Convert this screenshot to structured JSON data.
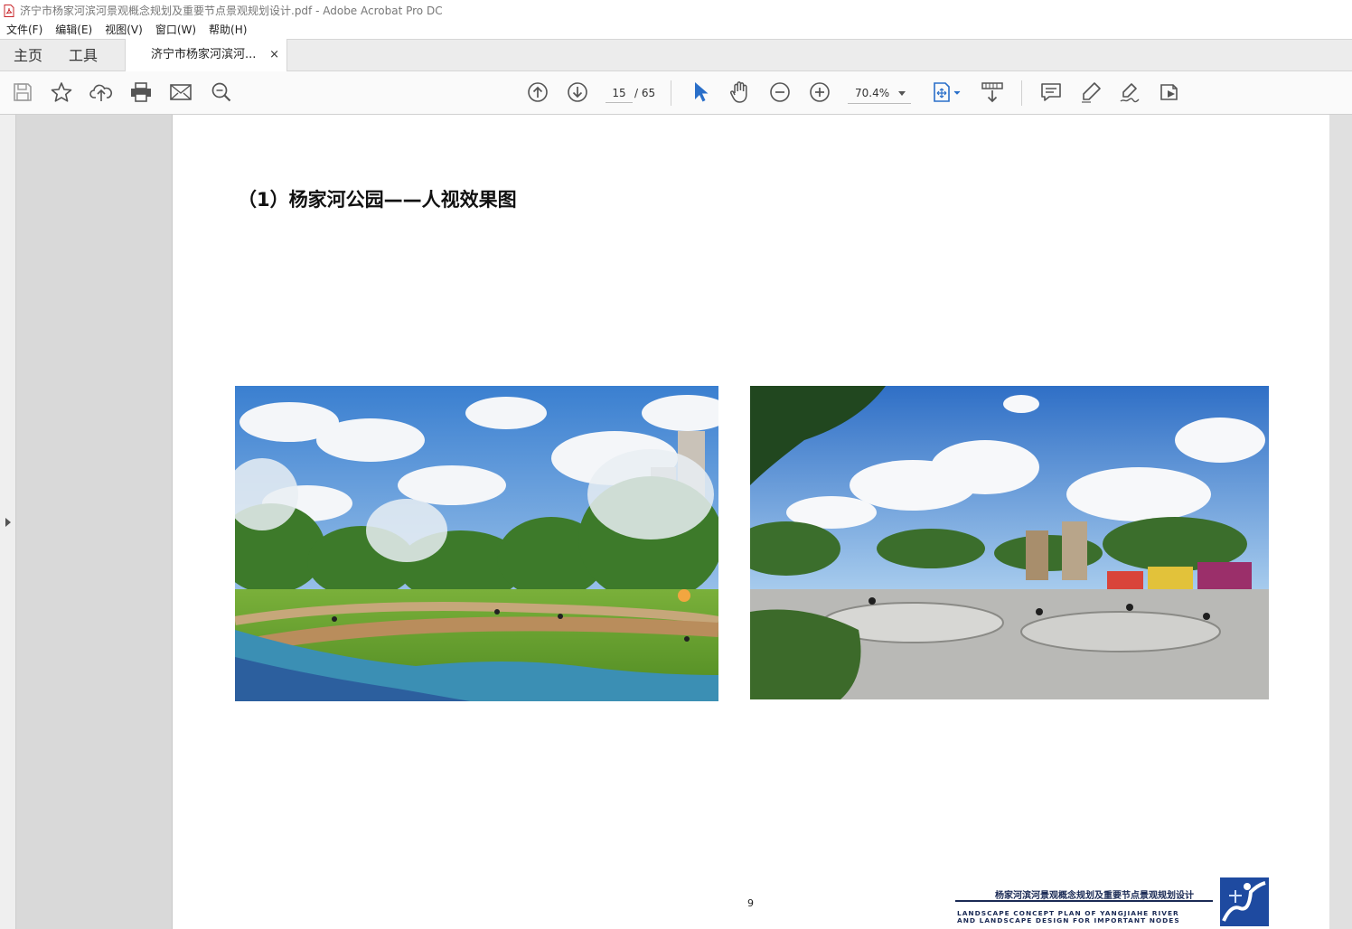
{
  "window": {
    "title": "济宁市杨家河滨河景观概念规划及重要节点景观规划设计.pdf - Adobe Acrobat Pro DC"
  },
  "menubar": {
    "items": [
      {
        "label": "文件(F)"
      },
      {
        "label": "编辑(E)"
      },
      {
        "label": "视图(V)"
      },
      {
        "label": "窗口(W)"
      },
      {
        "label": "帮助(H)"
      }
    ]
  },
  "tabs": {
    "home": "主页",
    "tools": "工具",
    "document": "济宁市杨家河滨河...",
    "close_glyph": "×"
  },
  "toolbar": {
    "page_current": "15",
    "page_total": "/ 65",
    "zoom": "70.4%",
    "icons": [
      "save-icon",
      "bookmark-star-icon",
      "upload-cloud-icon",
      "print-icon",
      "email-icon",
      "search-zoom-icon",
      "prev-page-icon",
      "next-page-icon",
      "select-arrow-icon",
      "hand-icon",
      "zoom-out-icon",
      "zoom-in-icon",
      "fit-page-icon",
      "scroll-mode-icon",
      "comment-icon",
      "highlight-pen-icon",
      "sign-icon",
      "more-tools-icon"
    ]
  },
  "document": {
    "heading": "（1）杨家河公园——人视效果图",
    "page_number": "9",
    "footer_cn": "杨家河滨河景观概念规划及重要节点景观规划设计",
    "footer_en_line1": "LANDSCAPE CONCEPT PLAN OF YANGJIAHE RIVER",
    "footer_en_line2": "AND LANDSCAPE DESIGN FOR IMPORTANT NODES",
    "images": [
      "park-lawn-render",
      "skatepark-render"
    ]
  },
  "colors": {
    "accent_blue": "#2a6fc9",
    "footer_navy": "#1a2a55",
    "workspace_gray": "#d9d9d9"
  }
}
